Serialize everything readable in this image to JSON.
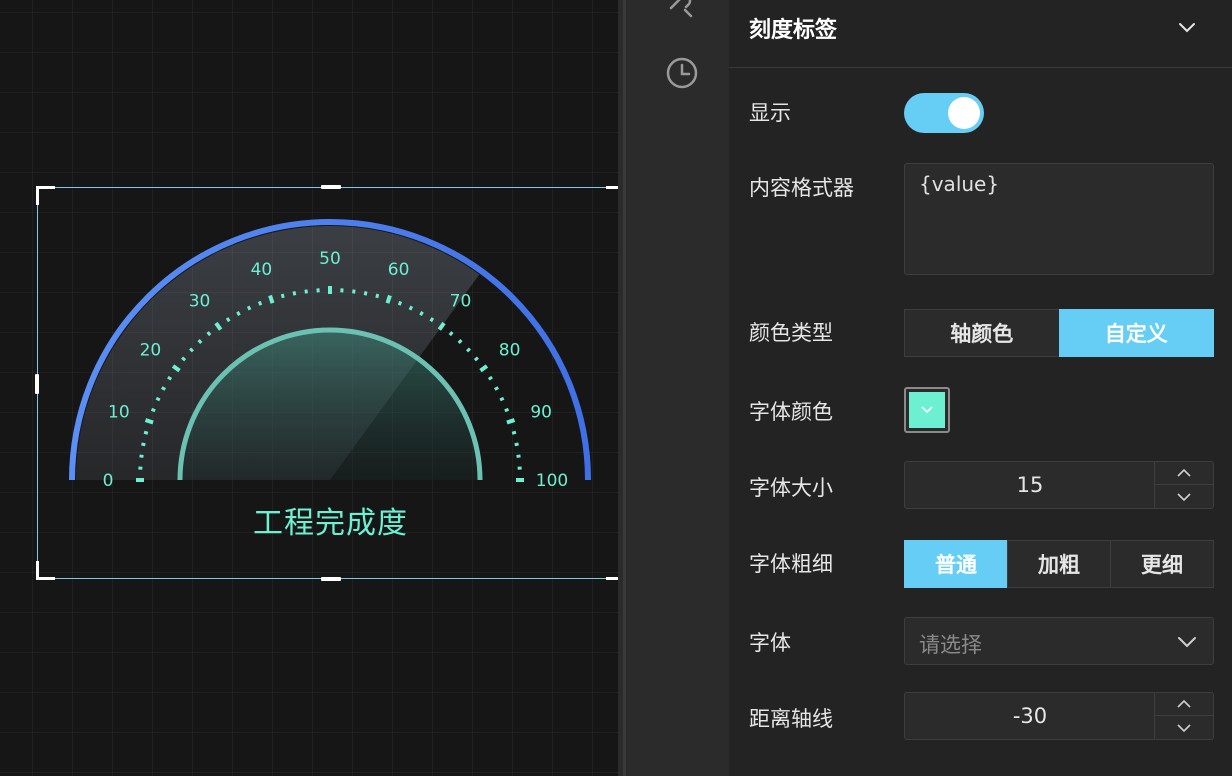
{
  "gauge": {
    "title": "工程完成度",
    "min": 0,
    "max": 100,
    "value": 70,
    "tick_labels": [
      "0",
      "10",
      "20",
      "30",
      "40",
      "50",
      "60",
      "70",
      "80",
      "90",
      "100"
    ],
    "colors": {
      "label": "#6df0d2",
      "ring": "#4f86f0",
      "inner_ring": "#6bc2b2"
    }
  },
  "panel": {
    "section_title": "刻度标签",
    "show": {
      "label": "显示",
      "value": true
    },
    "formatter": {
      "label": "内容格式器",
      "value": "{value}"
    },
    "color_type": {
      "label": "颜色类型",
      "options": [
        "轴颜色",
        "自定义"
      ],
      "selected": "自定义"
    },
    "font_color": {
      "label": "字体颜色",
      "value": "#6df0d2"
    },
    "font_size": {
      "label": "字体大小",
      "value": "15"
    },
    "font_weight": {
      "label": "字体粗细",
      "options": [
        "普通",
        "加粗",
        "更细"
      ],
      "selected": "普通"
    },
    "font_family": {
      "label": "字体",
      "placeholder": "请选择"
    },
    "axis_distance": {
      "label": "距离轴线",
      "value": "-30"
    }
  },
  "icons": {
    "top": "tools-icon",
    "history": "clock-icon"
  },
  "accent_color": "#66cef5"
}
